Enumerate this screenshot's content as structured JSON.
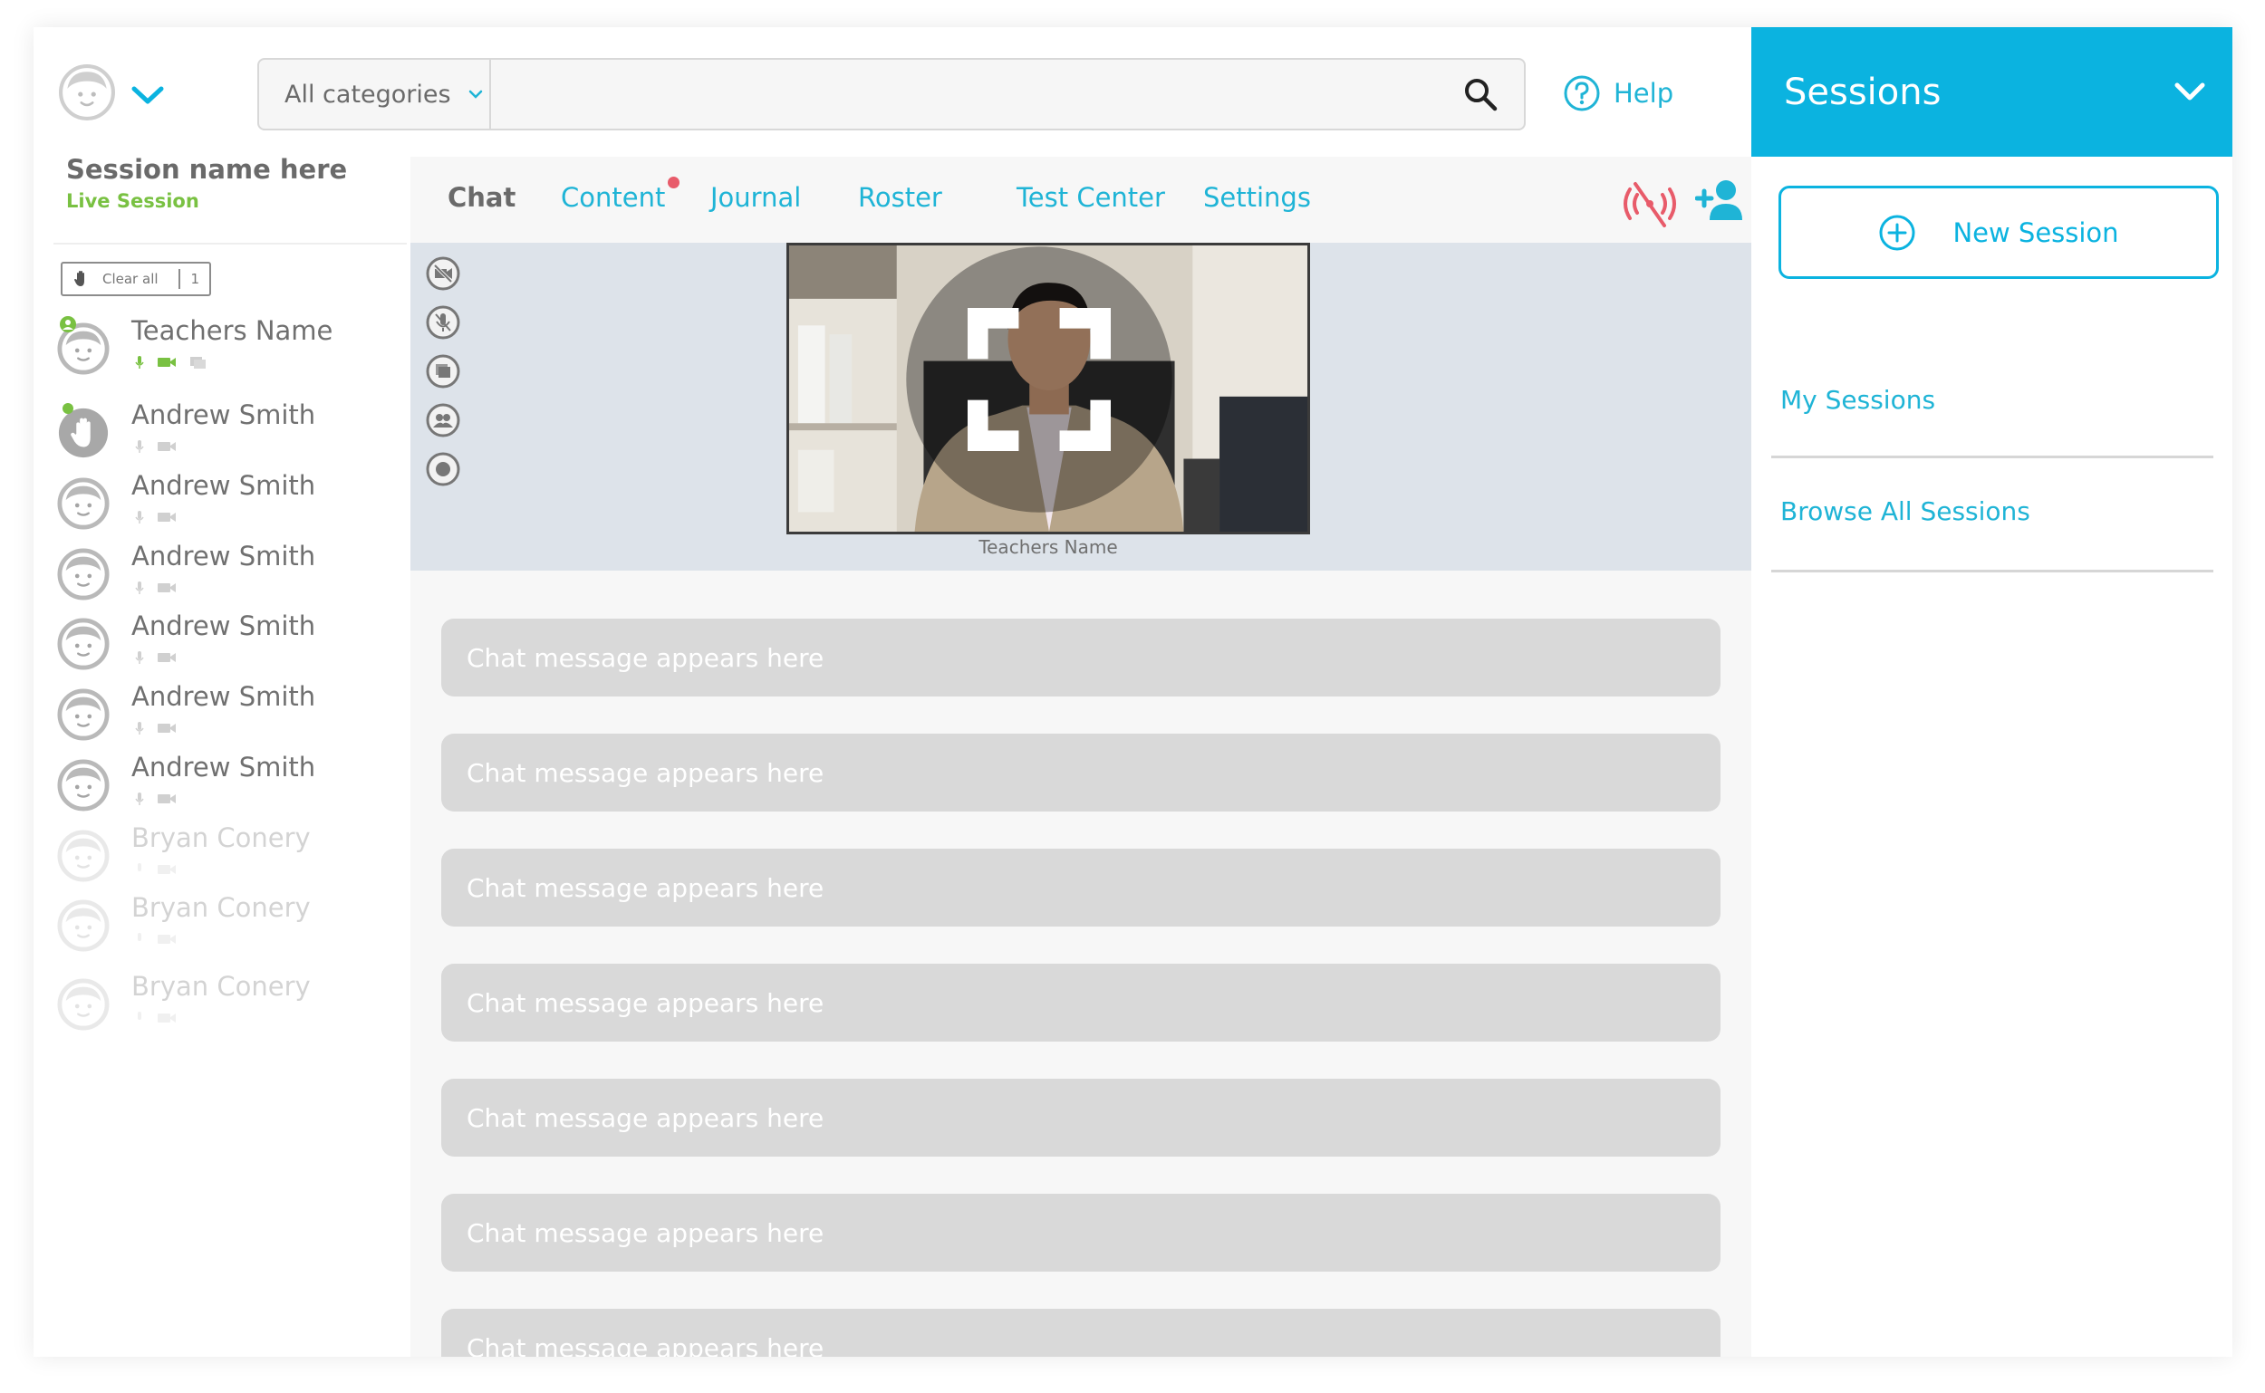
{
  "header": {
    "category": "All categories",
    "search_placeholder": "",
    "help_label": "Help"
  },
  "session": {
    "name": "Session name here",
    "status": "Live Session"
  },
  "roster": {
    "clear_all_label": "Clear all",
    "raised_count": "1",
    "participants": [
      {
        "name": "Teachers Name"
      },
      {
        "name": "Andrew Smith"
      },
      {
        "name": "Andrew Smith"
      },
      {
        "name": "Andrew Smith"
      },
      {
        "name": "Andrew Smith"
      },
      {
        "name": "Andrew Smith"
      },
      {
        "name": "Andrew Smith"
      },
      {
        "name": "Bryan Conery"
      },
      {
        "name": "Bryan Conery"
      },
      {
        "name": "Bryan Conery"
      }
    ]
  },
  "tabs": [
    {
      "label": "Chat"
    },
    {
      "label": "Content"
    },
    {
      "label": "Journal"
    },
    {
      "label": "Roster"
    },
    {
      "label": "Test Center"
    },
    {
      "label": "Settings"
    }
  ],
  "video": {
    "caption": "Teachers Name"
  },
  "chat": {
    "messages": [
      "Chat message appears here",
      "Chat message appears here",
      "Chat message appears here",
      "Chat message appears here",
      "Chat message appears here",
      "Chat message appears here",
      "Chat message appears here"
    ]
  },
  "sessions": {
    "title": "Sessions",
    "new_session_label": "New Session",
    "my_sessions_label": "My Sessions",
    "browse_all_label": "Browse All Sessions"
  },
  "colors": {
    "accent": "#0bb3e0",
    "link": "#1fb4d6",
    "live": "#79c142",
    "badge": "#e85b6a",
    "disconnect": "#e85b6a"
  }
}
